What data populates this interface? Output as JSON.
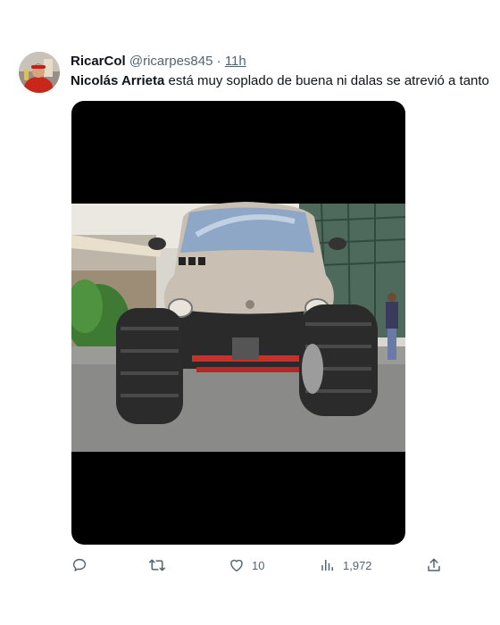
{
  "user": {
    "display_name": "RicarCol",
    "handle": "@ricarpes845",
    "separator": "·",
    "time": "11h"
  },
  "tweet": {
    "mention": "Nicolás Arrieta",
    "text": " está muy soplado de buena ni dalas se atrevió a tanto"
  },
  "media": {
    "description_icon": "photo-lifted-car"
  },
  "actions": {
    "reply_count": "",
    "retweet_count": "",
    "like_count": "10",
    "views_count": "1,972"
  },
  "colors": {
    "text_primary": "#0f1419",
    "text_secondary": "#536471",
    "media_bg": "#000000"
  }
}
